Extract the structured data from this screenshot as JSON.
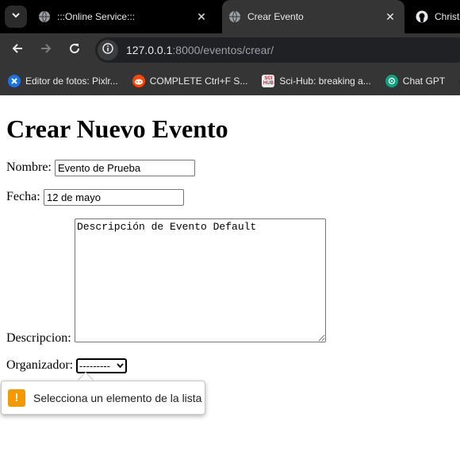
{
  "browser": {
    "tabs": [
      {
        "title": ":::Online Service:::",
        "icon": "globe-icon",
        "close": "✕"
      },
      {
        "title": "Crear Evento",
        "icon": "globe-icon",
        "close": "✕",
        "active": true
      },
      {
        "title": "Christo",
        "icon": "github-icon"
      }
    ],
    "url": {
      "host": "127.0.0.1",
      "path": ":8000/eventos/crear/"
    },
    "bookmarks": [
      {
        "label": "Editor de fotos: Pixlr...",
        "icon": "pixlr-icon",
        "color": "#1a73e8"
      },
      {
        "label": "COMPLETE Ctrl+F S...",
        "icon": "reddit-icon",
        "color": "#ff4500"
      },
      {
        "label": "Sci-Hub: breaking a...",
        "icon": "scihub-icon",
        "color": "#c62828"
      },
      {
        "label": "Chat GPT",
        "icon": "chatgpt-icon",
        "color": "#10a37f"
      }
    ]
  },
  "page": {
    "title": "Crear Nuevo Evento",
    "form": {
      "nombre_label": "Nombre:",
      "nombre_value": "Evento de Prueba",
      "fecha_label": "Fecha:",
      "fecha_value": "12 de mayo",
      "descripcion_label": "Descripcion:",
      "descripcion_value": "Descripción de Evento Default",
      "organizador_label": "Organizador:",
      "organizador_selected": "---------"
    },
    "validation": {
      "message": "Selecciona un elemento de la lista",
      "icon": "warning-icon",
      "color": "#f29900"
    }
  }
}
